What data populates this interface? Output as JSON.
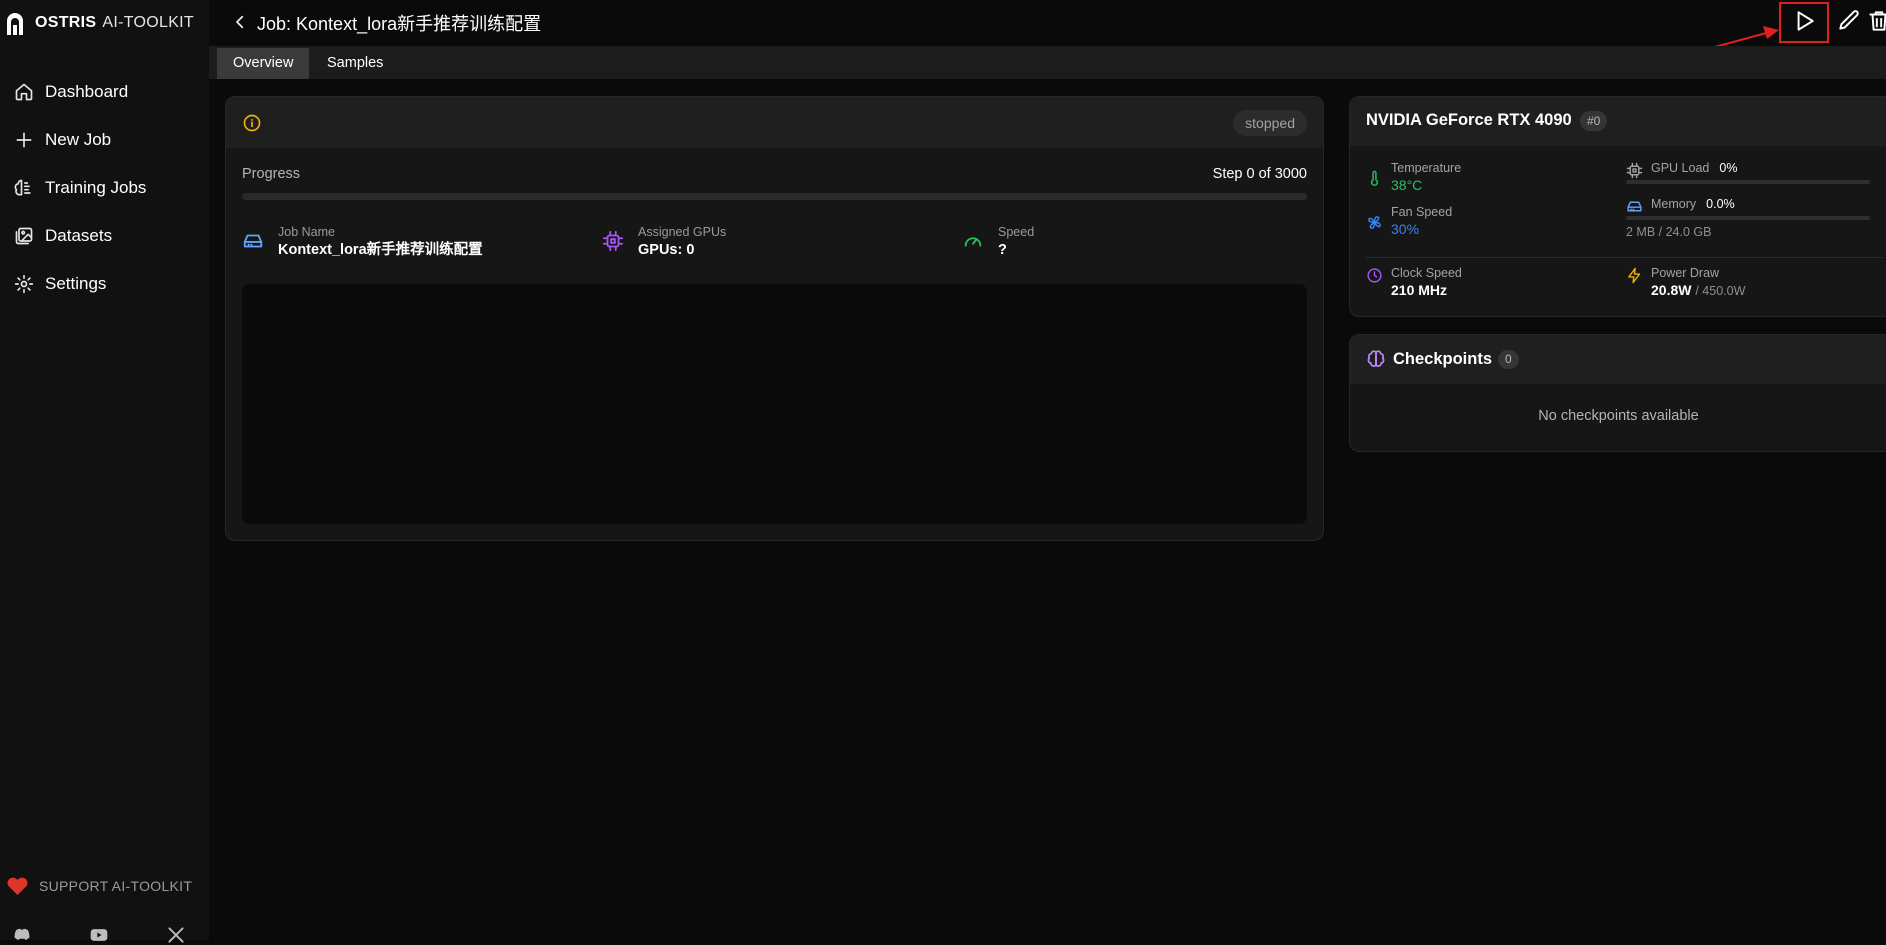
{
  "app": {
    "brand_primary": "OSTRIS",
    "brand_secondary": "AI-TOOLKIT"
  },
  "sidebar": {
    "items": [
      {
        "label": "Dashboard",
        "icon": "home-icon"
      },
      {
        "label": "New Job",
        "icon": "plus-icon"
      },
      {
        "label": "Training Jobs",
        "icon": "brain-icon"
      },
      {
        "label": "Datasets",
        "icon": "images-icon"
      },
      {
        "label": "Settings",
        "icon": "gear-icon"
      }
    ],
    "support_label": "SUPPORT AI-TOOLKIT",
    "socials": [
      "discord-icon",
      "youtube-icon",
      "x-icon"
    ]
  },
  "header": {
    "title": "Job: Kontext_lora新手推荐训练配置",
    "actions": [
      "play-icon",
      "edit-icon",
      "trash-icon"
    ]
  },
  "tabs": [
    {
      "label": "Overview",
      "active": true
    },
    {
      "label": "Samples",
      "active": false
    }
  ],
  "job": {
    "status": "stopped",
    "progress_label": "Progress",
    "progress_text": "Step 0 of 3000",
    "progress_fraction": 0,
    "stats": {
      "job_name_label": "Job Name",
      "job_name_value": "Kontext_lora新手推荐训练配置",
      "gpus_label": "Assigned GPUs",
      "gpus_value": "GPUs: 0",
      "speed_label": "Speed",
      "speed_value": "?"
    }
  },
  "gpu": {
    "name": "NVIDIA GeForce RTX 4090",
    "index": "#0",
    "temperature_label": "Temperature",
    "temperature_value": "38°C",
    "fan_label": "Fan Speed",
    "fan_value": "30%",
    "load_label": "GPU Load",
    "load_value": "0%",
    "load_fraction": 0,
    "memory_label": "Memory",
    "memory_value": "0.0%",
    "memory_fraction": 0,
    "memory_detail": "2 MB / 24.0 GB",
    "clock_label": "Clock Speed",
    "clock_value": "210 MHz",
    "power_label": "Power Draw",
    "power_value": "20.8W",
    "power_max": "/ 450.0W",
    "colors": {
      "temperature": "#22c55e",
      "fan": "#3b82f6",
      "clock": "#a855f7",
      "power": "#eab308"
    }
  },
  "checkpoints": {
    "title": "Checkpoints",
    "count": "0",
    "empty_text": "No checkpoints available"
  }
}
